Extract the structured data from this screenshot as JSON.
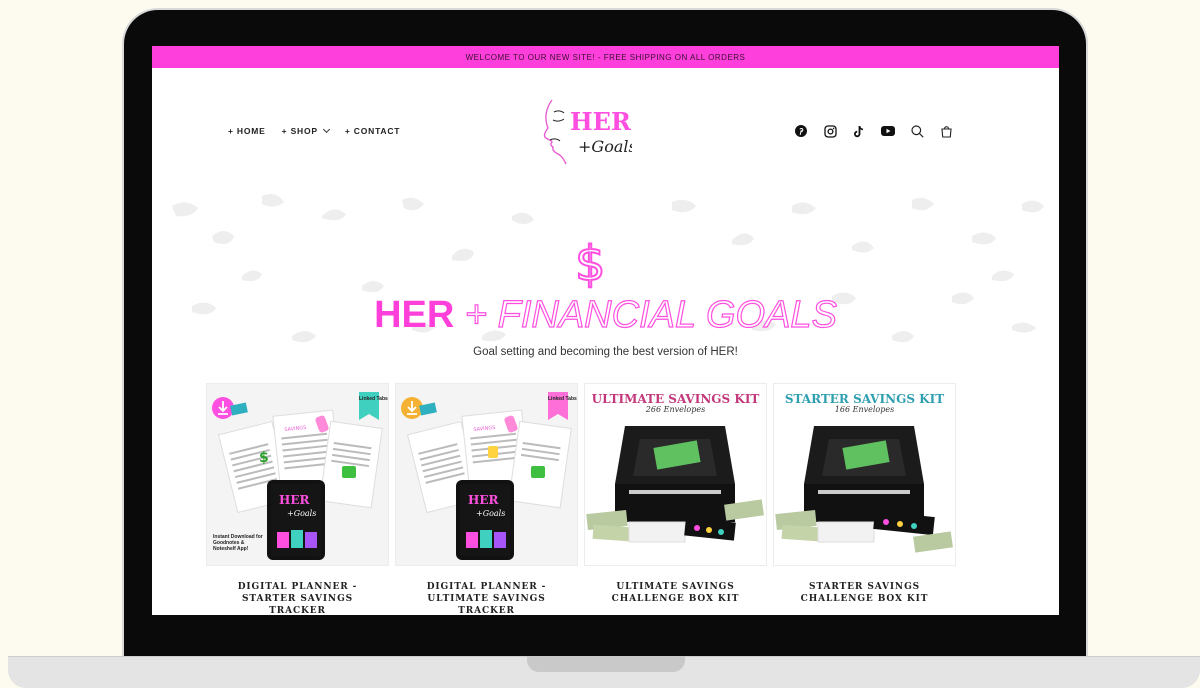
{
  "announcement": "WELCOME TO OUR NEW SITE! - FREE SHIPPING ON ALL ORDERS",
  "nav": {
    "home": "+ HOME",
    "shop": "+ SHOP",
    "contact": "+ CONTACT"
  },
  "logo": {
    "text_her": "HER",
    "text_goals": "+Goals"
  },
  "header_icons": [
    "pinterest-icon",
    "instagram-icon",
    "tiktok-icon",
    "youtube-icon",
    "search-icon",
    "cart-icon"
  ],
  "hero": {
    "symbol": "$",
    "title_her": "HER",
    "title_rest": "+ FINANCIAL GOALS",
    "subtitle": "Goal setting and becoming the best version of HER!"
  },
  "colors": {
    "accent": "#ff3fdc",
    "teal": "#3fbfbf",
    "dark": "#0a0a0a"
  },
  "products": [
    {
      "title": "DIGITAL PLANNER - STARTER SAVINGS TRACKER",
      "badge": "Linked Tabs",
      "note": "Instant Download for Goodnotes & Noteshelf App!",
      "tablet_logo": "HER +Goals",
      "tablet_caption": "Savings Tracker"
    },
    {
      "title": "DIGITAL PLANNER - ULTIMATE SAVINGS TRACKER",
      "badge": "Linked Tabs",
      "tablet_logo": "HER +Goals",
      "tablet_caption": "Savings Tracker"
    },
    {
      "title": "ULTIMATE SAVINGS CHALLENGE BOX KIT",
      "kit_title": "ULTIMATE SAVINGS KIT",
      "kit_sub": "266 Envelopes"
    },
    {
      "title": "STARTER SAVINGS CHALLENGE BOX KIT",
      "kit_title": "STARTER SAVINGS KIT",
      "kit_sub": "166 Envelopes"
    }
  ]
}
